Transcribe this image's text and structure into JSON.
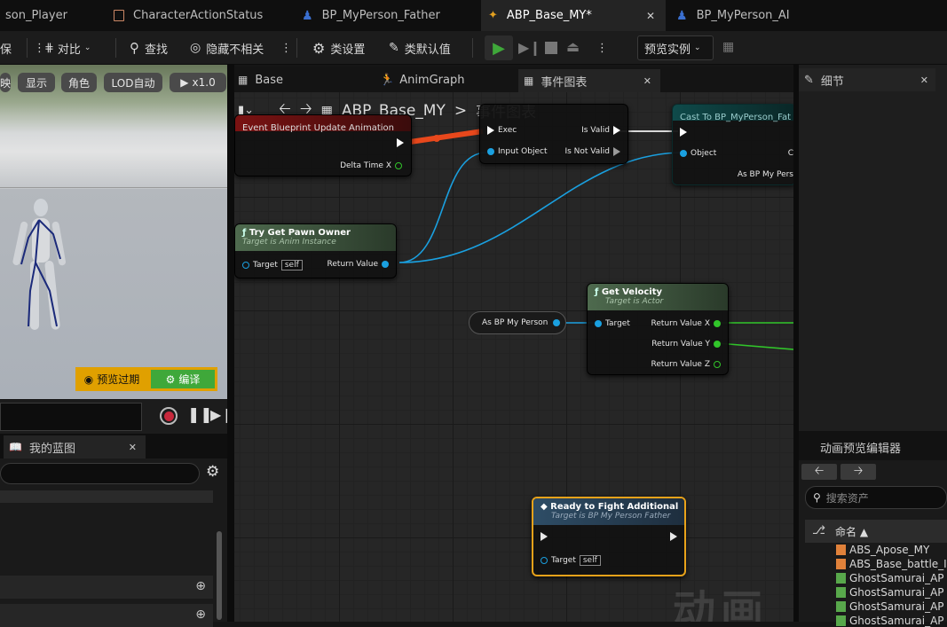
{
  "tabs": [
    {
      "label": "son_Player"
    },
    {
      "label": "CharacterActionStatus"
    },
    {
      "label": "BP_MyPerson_Father"
    },
    {
      "label": "ABP_Base_MY*"
    },
    {
      "label": "BP_MyPerson_AI"
    }
  ],
  "toolbar": {
    "cut_label": "保",
    "diff_label": "对比",
    "find_label": "查找",
    "hide_label": "隐藏不相关",
    "class_settings_label": "类设置",
    "class_defaults_label": "类默认值",
    "preview_instance_label": "预览实例"
  },
  "viewport": {
    "buttons": [
      "映",
      "显示",
      "角色",
      "LOD自动",
      "x1.0"
    ],
    "preview_expired_label": "预览过期",
    "compile_label": "编译"
  },
  "my_blueprint": {
    "tab_label": "我的蓝图"
  },
  "graph_tabs": {
    "base": "Base",
    "anim_graph": "AnimGraph",
    "event_graph": "事件图表"
  },
  "breadcrumb": {
    "root": "ABP_Base_MY",
    "separator": ">",
    "current": "事件图表"
  },
  "nodes": {
    "event_update": {
      "title": "Event Blueprint Update Animation",
      "pin_delta": "Delta Time X"
    },
    "is_valid": {
      "pin_exec": "Exec",
      "pin_input": "Input Object",
      "pin_valid": "Is Valid",
      "pin_not_valid": "Is Not Valid"
    },
    "cast": {
      "title": "Cast To BP_MyPerson_Fat",
      "pin_object": "Object",
      "pin_as": "As BP My Pers",
      "pin_c": "C"
    },
    "try_get_pawn": {
      "title": "Try Get Pawn Owner",
      "subtitle": "Target is Anim Instance",
      "pin_target": "Target",
      "self": "self",
      "pin_return": "Return Value"
    },
    "get_velocity": {
      "title": "Get Velocity",
      "subtitle": "Target is Actor",
      "pin_target": "Target",
      "ret_x": "Return Value X",
      "ret_y": "Return Value Y",
      "ret_z": "Return Value Z"
    },
    "as_bp": {
      "label": "As BP My Person"
    },
    "ready_fight": {
      "title": "Ready to Fight Additional",
      "subtitle": "Target is BP My Person Father",
      "pin_target": "Target",
      "self": "self"
    }
  },
  "watermark": "动画",
  "details": {
    "tab_label": "细节"
  },
  "anim_preview": {
    "tab_label": "动画预览编辑器",
    "search_placeholder": "搜索资产",
    "name_header": "命名",
    "assets": [
      {
        "name": "ABS_Apose_MY",
        "color": "#e0813a"
      },
      {
        "name": "ABS_Base_battle_I",
        "color": "#e0813a"
      },
      {
        "name": "GhostSamurai_AP",
        "color": "#58a84b"
      },
      {
        "name": "GhostSamurai_AP",
        "color": "#58a84b"
      },
      {
        "name": "GhostSamurai_AP",
        "color": "#58a84b"
      },
      {
        "name": "GhostSamurai_AP",
        "color": "#58a84b"
      }
    ]
  },
  "colors": {
    "accent_green": "#3fa83a",
    "exec_red": "#e8481c",
    "object_blue": "#1aa0e0",
    "float_green": "#31c52a",
    "warning_yellow": "#e0a000"
  }
}
